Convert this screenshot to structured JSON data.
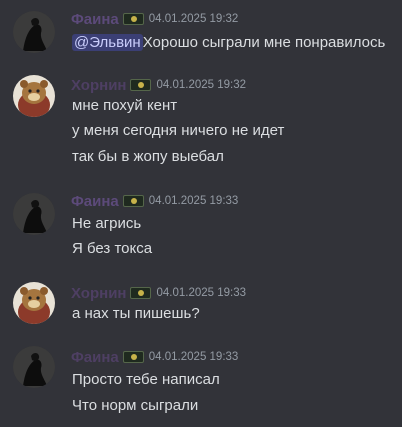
{
  "messages": [
    {
      "author": "Фаина",
      "timestamp": "04.01.2025 19:32",
      "mention": "@Эльвин",
      "lines": [
        "Хорошо сыграли мне понравилось"
      ]
    },
    {
      "author": "Хорнин",
      "timestamp": "04.01.2025 19:32",
      "lines": [
        "мне похуй кент",
        "у меня сегодня ничего не идет",
        "так бы в жопу выебал"
      ]
    },
    {
      "author": "Фаина",
      "timestamp": "04.01.2025 19:33",
      "lines": [
        "Не агрись",
        "Я без токса"
      ]
    },
    {
      "author": "Хорнин",
      "timestamp": "04.01.2025 19:33",
      "lines": [
        "а нах ты пишешь?"
      ]
    },
    {
      "author": "Фаина",
      "timestamp": "04.01.2025 19:33",
      "lines": [
        "Просто тебе написал",
        "Что норм сыграли"
      ]
    }
  ],
  "colors": {
    "background": "#323339",
    "text": "#dbdee1",
    "timestamp": "#949ba4",
    "mention_bg": "#3b3f75",
    "username": "#5c4a7a"
  },
  "icons": {
    "dark_avatar": "dark-figure-avatar-icon",
    "chipmunk_avatar": "chipmunk-avatar-icon",
    "role_tag": "role-tag-icon"
  }
}
